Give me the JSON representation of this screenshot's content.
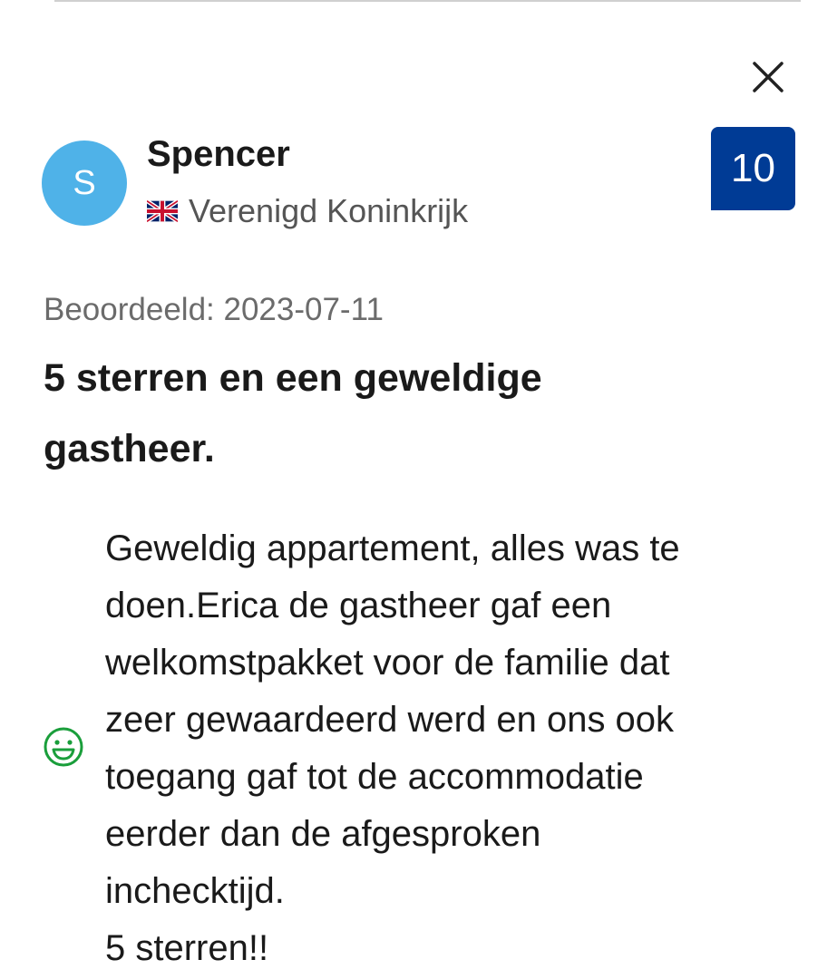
{
  "reviewer": {
    "name": "Spencer",
    "avatar_initial": "S",
    "country": "Verenigd Koninkrijk",
    "country_flag_icon": "uk-flag-icon"
  },
  "score": "10",
  "review": {
    "date": "Beoordeeld: 2023-07-11",
    "title": "5 sterren en een geweldige gastheer.",
    "sentiment_icon": "smiley-icon",
    "body_lines": [
      "Geweldig appartement, alles was te",
      "doen.Erica de gastheer gaf een",
      "welkomstpakket voor de familie dat",
      "zeer gewaardeerd werd en ons ook",
      "toegang gaf tot de accommodatie",
      "eerder dan de afgesproken",
      "inchecktijd.",
      "5 sterren!!"
    ]
  },
  "colors": {
    "avatar": "#4fb2e8",
    "score_badge": "#003b95",
    "smiley": "#1a9e3b"
  }
}
